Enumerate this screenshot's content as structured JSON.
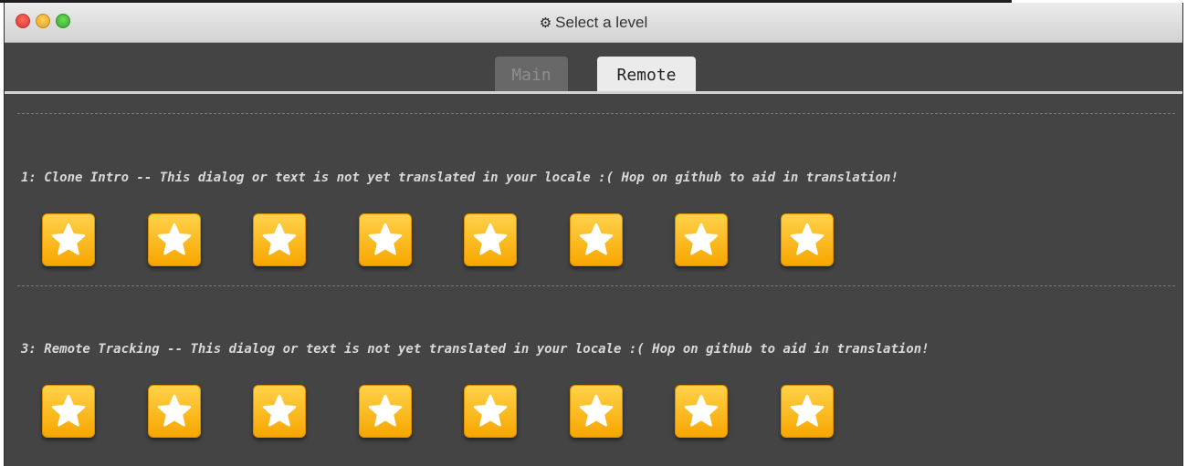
{
  "window": {
    "title": "Select a level",
    "title_icon": "gear-icon"
  },
  "tabs": [
    {
      "label": "Main",
      "active": false
    },
    {
      "label": "Remote",
      "active": true
    }
  ],
  "levels": [
    {
      "title": "1: Clone Intro -- This dialog or text is not yet translated in your locale :( Hop on github to aid in translation!",
      "star_count": 8,
      "star_icon": "star-icon"
    },
    {
      "title": "3: Remote Tracking -- This dialog or text is not yet translated in your locale :( Hop on github to aid in translation!",
      "star_count": 8,
      "star_icon": "star-icon"
    }
  ],
  "colors": {
    "window_bg": "#444444",
    "star_button_top": "#ffd24a",
    "star_button_bottom": "#f7a600",
    "star_fill": "#ffffff"
  }
}
